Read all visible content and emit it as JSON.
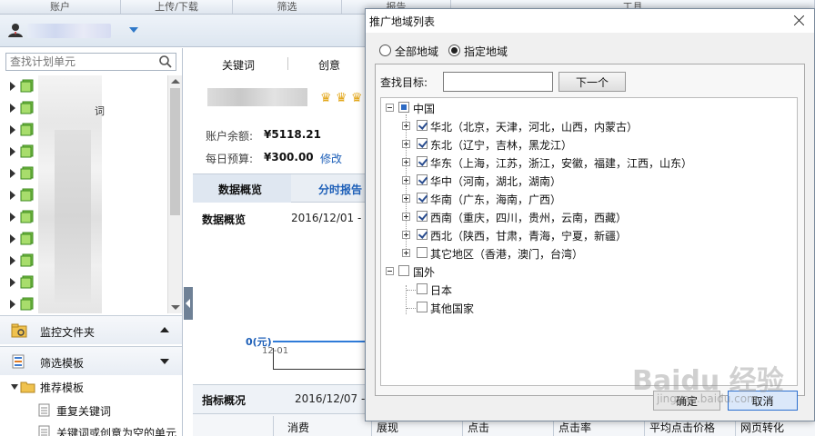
{
  "top_menu": [
    "账户",
    "上传/下载",
    "筛选",
    "报告",
    "工具"
  ],
  "left": {
    "search_placeholder": "查找计划单元",
    "tree_fragment": "词",
    "folder_section": "监控文件夹",
    "filter_section": "筛选模板",
    "recommended": "推荐模板",
    "items": [
      "重复关键词",
      "关键词或创意为空的单元"
    ]
  },
  "main": {
    "tabs": [
      "关键词",
      "创意"
    ],
    "balance_label": "账户余额:",
    "balance_value": "¥5118.21",
    "budget_label": "每日预算:",
    "budget_value": "¥300.00",
    "edit_link": "修改",
    "subtabs": [
      "数据概览",
      "分时报告"
    ],
    "overview_title": "数据概览",
    "overview_date": "2016/12/01 - 2",
    "chart_zero": "0(元)",
    "chart_x": "12-01",
    "indicator_title": "指标概况",
    "indicator_date": "2016/12/07 -",
    "table_headers": [
      "消费",
      "展现",
      "点击",
      "点击率",
      "平均点击价格",
      "网页转化"
    ]
  },
  "dialog": {
    "title": "推广地域列表",
    "radio_all": "全部地域",
    "radio_selected": "指定地域",
    "find_label": "查找目标:",
    "find_value": "",
    "next_button": "下一个",
    "ok_button": "确定",
    "cancel_button": "取消",
    "tree": {
      "china": "中国",
      "regions": [
        {
          "label": "华北（北京，天津，河北，山西，内蒙古）",
          "checked": true
        },
        {
          "label": "东北（辽宁，吉林，黑龙江）",
          "checked": true
        },
        {
          "label": "华东（上海，江苏，浙江，安徽，福建，江西，山东）",
          "checked": true
        },
        {
          "label": "华中（河南，湖北，湖南）",
          "checked": true
        },
        {
          "label": "华南（广东，海南，广西）",
          "checked": true
        },
        {
          "label": "西南（重庆，四川，贵州，云南，西藏）",
          "checked": true
        },
        {
          "label": "西北（陕西，甘肃，青海，宁夏，新疆）",
          "checked": true
        },
        {
          "label": "其它地区（香港，澳门，台湾）",
          "checked": false
        }
      ],
      "foreign": "国外",
      "foreign_children": [
        "日本",
        "其他国家"
      ]
    }
  },
  "watermark": {
    "main": "Baidu 经验",
    "sub": "jingyan.baidu.com"
  }
}
